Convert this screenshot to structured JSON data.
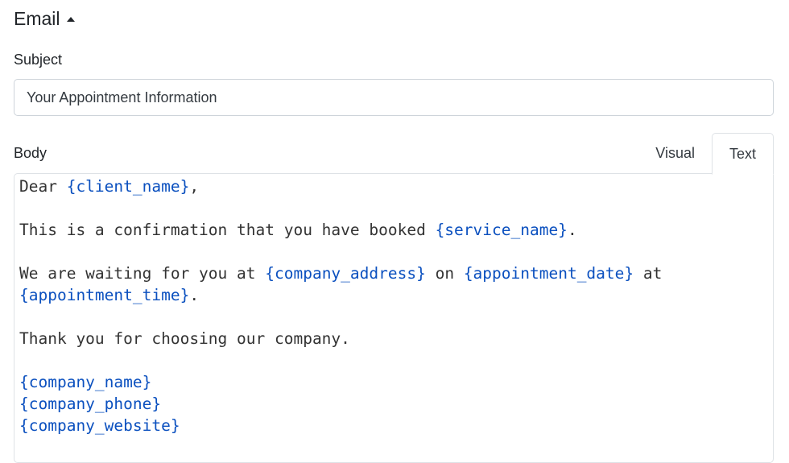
{
  "section": {
    "title": "Email",
    "toggle_icon": "caret-up-icon"
  },
  "subject": {
    "label": "Subject",
    "value": "Your Appointment Information"
  },
  "body": {
    "label": "Body",
    "tabs": [
      {
        "label": "Visual",
        "active": false
      },
      {
        "label": "Text",
        "active": true
      }
    ],
    "colors": {
      "text": "#333333",
      "placeholder": "#0b50bf"
    },
    "lines": [
      [
        {
          "t": "Dear "
        },
        {
          "t": "{client_name}",
          "ph": true
        },
        {
          "t": ","
        }
      ],
      [],
      [
        {
          "t": "This is a confirmation that you have booked "
        },
        {
          "t": "{service_name}",
          "ph": true
        },
        {
          "t": "."
        }
      ],
      [],
      [
        {
          "t": "We are waiting for you at "
        },
        {
          "t": "{company_address}",
          "ph": true
        },
        {
          "t": " on "
        },
        {
          "t": "{appointment_date}",
          "ph": true
        },
        {
          "t": " at"
        }
      ],
      [
        {
          "t": "{appointment_time}",
          "ph": true
        },
        {
          "t": "."
        }
      ],
      [],
      [
        {
          "t": "Thank you for choosing our company."
        }
      ],
      [],
      [
        {
          "t": "{company_name}",
          "ph": true
        }
      ],
      [
        {
          "t": "{company_phone}",
          "ph": true
        }
      ],
      [
        {
          "t": "{company_website}",
          "ph": true
        }
      ]
    ]
  }
}
